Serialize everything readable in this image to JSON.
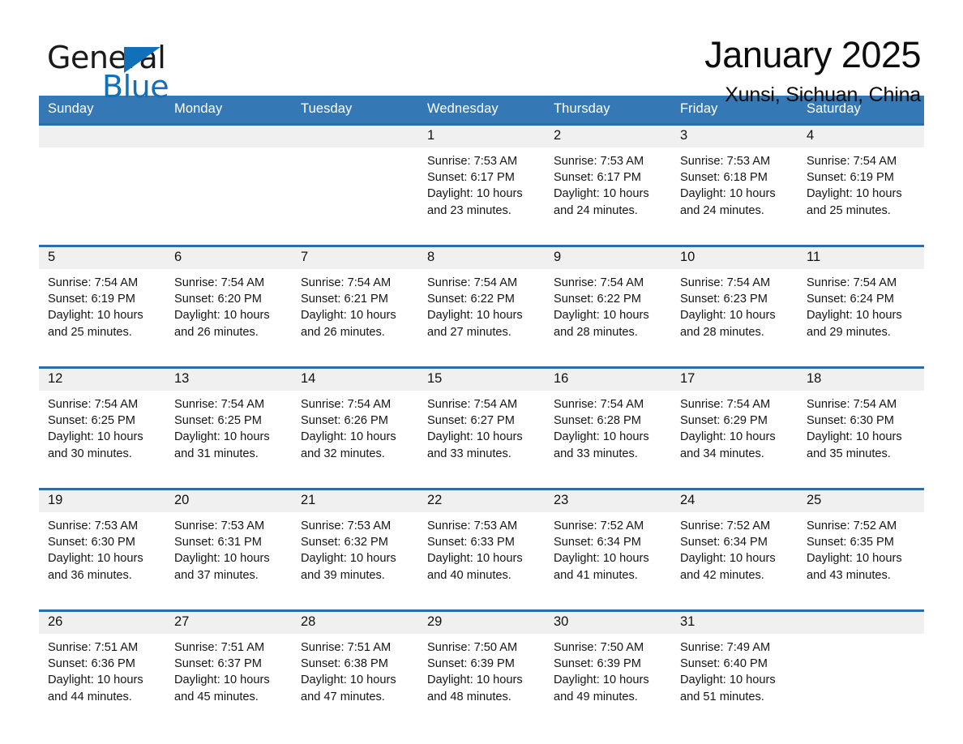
{
  "logo": {
    "word_one": "General",
    "word_two": "Blue",
    "mark": "triangle-icon"
  },
  "header": {
    "month_title": "January 2025",
    "location": "Xunsi, Sichuan, China"
  },
  "calendar": {
    "weekday_headers": [
      "Sunday",
      "Monday",
      "Tuesday",
      "Wednesday",
      "Thursday",
      "Friday",
      "Saturday"
    ],
    "accent_color": "#3479b6",
    "row_border_color": "#2e6da4",
    "daynum_background": "#f0f0f0",
    "weeks": [
      [
        {
          "day": "",
          "info": ""
        },
        {
          "day": "",
          "info": ""
        },
        {
          "day": "",
          "info": ""
        },
        {
          "day": "1",
          "info": "Sunrise: 7:53 AM\nSunset: 6:17 PM\nDaylight: 10 hours\nand 23 minutes."
        },
        {
          "day": "2",
          "info": "Sunrise: 7:53 AM\nSunset: 6:17 PM\nDaylight: 10 hours\nand 24 minutes."
        },
        {
          "day": "3",
          "info": "Sunrise: 7:53 AM\nSunset: 6:18 PM\nDaylight: 10 hours\nand 24 minutes."
        },
        {
          "day": "4",
          "info": "Sunrise: 7:54 AM\nSunset: 6:19 PM\nDaylight: 10 hours\nand 25 minutes."
        }
      ],
      [
        {
          "day": "5",
          "info": "Sunrise: 7:54 AM\nSunset: 6:19 PM\nDaylight: 10 hours\nand 25 minutes."
        },
        {
          "day": "6",
          "info": "Sunrise: 7:54 AM\nSunset: 6:20 PM\nDaylight: 10 hours\nand 26 minutes."
        },
        {
          "day": "7",
          "info": "Sunrise: 7:54 AM\nSunset: 6:21 PM\nDaylight: 10 hours\nand 26 minutes."
        },
        {
          "day": "8",
          "info": "Sunrise: 7:54 AM\nSunset: 6:22 PM\nDaylight: 10 hours\nand 27 minutes."
        },
        {
          "day": "9",
          "info": "Sunrise: 7:54 AM\nSunset: 6:22 PM\nDaylight: 10 hours\nand 28 minutes."
        },
        {
          "day": "10",
          "info": "Sunrise: 7:54 AM\nSunset: 6:23 PM\nDaylight: 10 hours\nand 28 minutes."
        },
        {
          "day": "11",
          "info": "Sunrise: 7:54 AM\nSunset: 6:24 PM\nDaylight: 10 hours\nand 29 minutes."
        }
      ],
      [
        {
          "day": "12",
          "info": "Sunrise: 7:54 AM\nSunset: 6:25 PM\nDaylight: 10 hours\nand 30 minutes."
        },
        {
          "day": "13",
          "info": "Sunrise: 7:54 AM\nSunset: 6:25 PM\nDaylight: 10 hours\nand 31 minutes."
        },
        {
          "day": "14",
          "info": "Sunrise: 7:54 AM\nSunset: 6:26 PM\nDaylight: 10 hours\nand 32 minutes."
        },
        {
          "day": "15",
          "info": "Sunrise: 7:54 AM\nSunset: 6:27 PM\nDaylight: 10 hours\nand 33 minutes."
        },
        {
          "day": "16",
          "info": "Sunrise: 7:54 AM\nSunset: 6:28 PM\nDaylight: 10 hours\nand 33 minutes."
        },
        {
          "day": "17",
          "info": "Sunrise: 7:54 AM\nSunset: 6:29 PM\nDaylight: 10 hours\nand 34 minutes."
        },
        {
          "day": "18",
          "info": "Sunrise: 7:54 AM\nSunset: 6:30 PM\nDaylight: 10 hours\nand 35 minutes."
        }
      ],
      [
        {
          "day": "19",
          "info": "Sunrise: 7:53 AM\nSunset: 6:30 PM\nDaylight: 10 hours\nand 36 minutes."
        },
        {
          "day": "20",
          "info": "Sunrise: 7:53 AM\nSunset: 6:31 PM\nDaylight: 10 hours\nand 37 minutes."
        },
        {
          "day": "21",
          "info": "Sunrise: 7:53 AM\nSunset: 6:32 PM\nDaylight: 10 hours\nand 39 minutes."
        },
        {
          "day": "22",
          "info": "Sunrise: 7:53 AM\nSunset: 6:33 PM\nDaylight: 10 hours\nand 40 minutes."
        },
        {
          "day": "23",
          "info": "Sunrise: 7:52 AM\nSunset: 6:34 PM\nDaylight: 10 hours\nand 41 minutes."
        },
        {
          "day": "24",
          "info": "Sunrise: 7:52 AM\nSunset: 6:34 PM\nDaylight: 10 hours\nand 42 minutes."
        },
        {
          "day": "25",
          "info": "Sunrise: 7:52 AM\nSunset: 6:35 PM\nDaylight: 10 hours\nand 43 minutes."
        }
      ],
      [
        {
          "day": "26",
          "info": "Sunrise: 7:51 AM\nSunset: 6:36 PM\nDaylight: 10 hours\nand 44 minutes."
        },
        {
          "day": "27",
          "info": "Sunrise: 7:51 AM\nSunset: 6:37 PM\nDaylight: 10 hours\nand 45 minutes."
        },
        {
          "day": "28",
          "info": "Sunrise: 7:51 AM\nSunset: 6:38 PM\nDaylight: 10 hours\nand 47 minutes."
        },
        {
          "day": "29",
          "info": "Sunrise: 7:50 AM\nSunset: 6:39 PM\nDaylight: 10 hours\nand 48 minutes."
        },
        {
          "day": "30",
          "info": "Sunrise: 7:50 AM\nSunset: 6:39 PM\nDaylight: 10 hours\nand 49 minutes."
        },
        {
          "day": "31",
          "info": "Sunrise: 7:49 AM\nSunset: 6:40 PM\nDaylight: 10 hours\nand 51 minutes."
        },
        {
          "day": "",
          "info": ""
        }
      ]
    ]
  }
}
